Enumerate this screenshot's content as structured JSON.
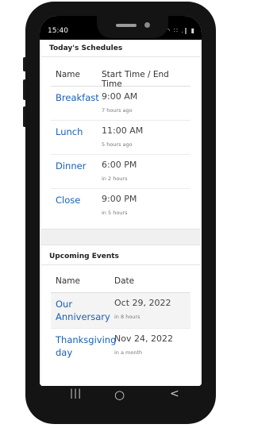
{
  "status_bar": {
    "time": "15:40",
    "icons": "◠ ∷ .∥ ▮"
  },
  "schedules": {
    "title": "Today's Schedules",
    "headers": [
      "Name",
      "Start Time / End Time"
    ],
    "rows": [
      {
        "name": "Breakfast",
        "time": "9:00 AM",
        "relative": "7 hours ago"
      },
      {
        "name": "Lunch",
        "time": "11:00 AM",
        "relative": "5 hours ago"
      },
      {
        "name": "Dinner",
        "time": "6:00 PM",
        "relative": "in 2 hours"
      },
      {
        "name": "Close",
        "time": "9:00 PM",
        "relative": "in 5 hours"
      }
    ]
  },
  "events": {
    "title": "Upcoming Events",
    "headers": [
      "Name",
      "Date"
    ],
    "rows": [
      {
        "name_line1": "Our",
        "name_line2": "Anniversary",
        "date": "Oct 29, 2022",
        "relative": "in 8 hours"
      },
      {
        "name_line1": "Thanksgiving",
        "name_line2": "day",
        "date": "Nov 24, 2022",
        "relative": "in a month"
      }
    ]
  },
  "nav": {
    "recent": "|||",
    "home": "○",
    "back": "<"
  },
  "colors": {
    "link": "#1a5fb4",
    "frame": "#141414",
    "background": "#f0f0f0"
  }
}
